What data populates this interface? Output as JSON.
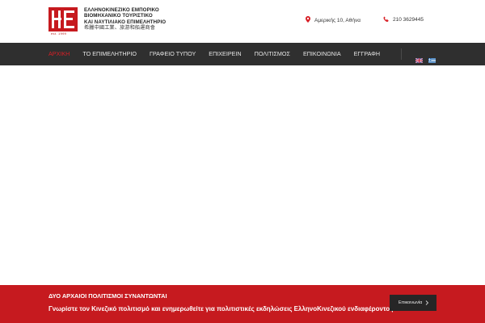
{
  "header": {
    "logo_text": "est. 1999",
    "org_name_lines": [
      "ΕΛΛΗΝΟΚΙΝΕΖΙΚΟ ΕΜΠΟΡΙΚΟ",
      "ΒΙΟΜΗΧΑΝΙΚΟ ΤΟΥΡΙΣΤΙΚΟ",
      "ΚΑΙ ΝΑΥΤΙΛΙΑΚΟ ΕΠΙΜΕΛΗΤΗΡΙΟ",
      "希臘中國工業、旅游和船運商會"
    ],
    "address": "Αμερικής 10, Αθήνα",
    "phone": "210 3629445"
  },
  "nav": {
    "items": [
      {
        "label": "ΑΡΧΙΚΗ",
        "active": true
      },
      {
        "label": "ΤΟ ΕΠΙΜΕΛΗΤΗΡΙΟ",
        "active": false
      },
      {
        "label": "ΓΡΑΦΕΙΟ ΤΥΠΟΥ",
        "active": false
      },
      {
        "label": "ΕΠΙΧΕΙΡΕΙΝ",
        "active": false
      },
      {
        "label": "ΠΟΛΙΤΙΣΜΟΣ",
        "active": false
      },
      {
        "label": "ΕΠΙΚΟΙΝΩΝΙΑ",
        "active": false
      },
      {
        "label": "ΕΓΓΡΑΦΗ",
        "active": false
      }
    ],
    "languages": [
      "english-flag-icon",
      "greek-flag-icon"
    ]
  },
  "banner": {
    "title": "ΔΥΟ ΑΡΧΑΙΟΙ ΠΟΛΙΤΙΣΜΟΙ ΣΥΝΑΝΤΩΝΤΑΙ",
    "subtitle": "Γνωρίστε τον Κινεζικό πολιτισμό και ενημερωθείτε για πολιτιστικές εκδηλώσεις ΕλληνοΚινεζικού ενδιαφέροντος",
    "button_label": "Επικοινωνία"
  },
  "colors": {
    "brand_red": "#c61a1f",
    "nav_bg": "#2f2f2f",
    "active_nav": "#d81f26"
  }
}
